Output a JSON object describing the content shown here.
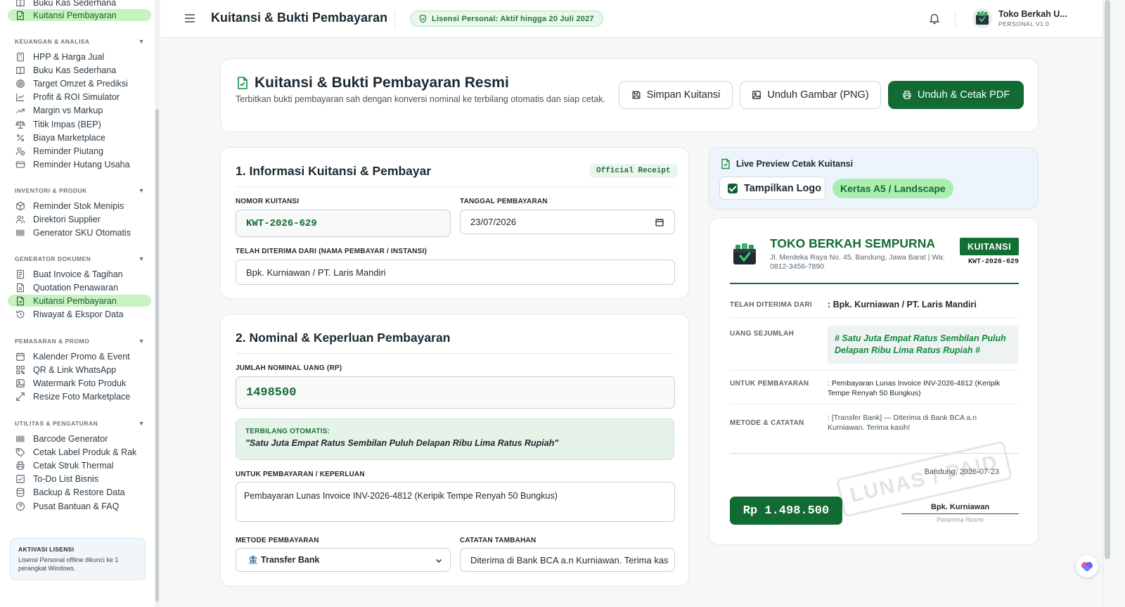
{
  "sidebar": {
    "top_partial": {
      "label": "Buku Kas Sederhana"
    },
    "top_active": {
      "label": "Kuitansi Pembayaran"
    },
    "sections": [
      {
        "title": "KEUANGAN & ANALISA",
        "items": [
          {
            "label": "HPP & Harga Jual",
            "icon": "calculator-icon"
          },
          {
            "label": "Buku Kas Sederhana",
            "icon": "book-icon"
          },
          {
            "label": "Target Omzet & Prediksi",
            "icon": "target-icon"
          },
          {
            "label": "Profit & ROI Simulator",
            "icon": "chart-line-icon"
          },
          {
            "label": "Margin vs Markup",
            "icon": "trending-up-icon"
          },
          {
            "label": "Titik Impas (BEP)",
            "icon": "scale-icon"
          },
          {
            "label": "Biaya Marketplace",
            "icon": "percent-icon"
          },
          {
            "label": "Reminder Piutang",
            "icon": "user-clock-icon"
          },
          {
            "label": "Reminder Hutang Usaha",
            "icon": "credit-card-icon"
          }
        ]
      },
      {
        "title": "INVENTORI & PRODUK",
        "items": [
          {
            "label": "Reminder Stok Menipis",
            "icon": "package-icon"
          },
          {
            "label": "Direktori Supplier",
            "icon": "users-icon"
          },
          {
            "label": "Generator SKU Otomatis",
            "icon": "barcode-icon"
          }
        ]
      },
      {
        "title": "GENERATOR DOKUMEN",
        "items": [
          {
            "label": "Buat Invoice & Tagihan",
            "icon": "invoice-icon"
          },
          {
            "label": "Quotation Penawaran",
            "icon": "document-icon"
          },
          {
            "label": "Kuitansi Pembayaran",
            "icon": "receipt-icon",
            "active": true
          },
          {
            "label": "Riwayat & Ekspor Data",
            "icon": "history-icon"
          }
        ]
      },
      {
        "title": "PEMASARAN & PROMO",
        "items": [
          {
            "label": "Kalender Promo & Event",
            "icon": "calendar-icon"
          },
          {
            "label": "QR & Link WhatsApp",
            "icon": "qr-icon"
          },
          {
            "label": "Watermark Foto Produk",
            "icon": "image-icon"
          },
          {
            "label": "Resize Foto Marketplace",
            "icon": "resize-icon"
          }
        ]
      },
      {
        "title": "UTILITAS & PENGATURAN",
        "items": [
          {
            "label": "Barcode Generator",
            "icon": "barcode-icon"
          },
          {
            "label": "Cetak Label Produk & Rak",
            "icon": "tag-icon"
          },
          {
            "label": "Cetak Struk Thermal",
            "icon": "printer-icon"
          },
          {
            "label": "To-Do List Bisnis",
            "icon": "checklist-icon"
          },
          {
            "label": "Backup & Restore Data",
            "icon": "database-icon"
          },
          {
            "label": "Pusat Bantuan & FAQ",
            "icon": "help-icon"
          }
        ]
      }
    ],
    "license": {
      "title": "AKTIVASI LISENSI",
      "text": "Lisensi Personal offline dikunci ke 1 perangkat Windows."
    }
  },
  "header": {
    "title": "Kuitansi & Bukti Pembayaran",
    "license_pill": "Lisensi Personal: Aktif hingga 20 Juli 2027",
    "user_name": "Toko Berkah U...",
    "user_sub": "PERSONAL V1.0"
  },
  "top_card": {
    "title": "Kuitansi & Bukti Pembayaran Resmi",
    "description": "Terbitkan bukti pembayaran sah dengan konversi nominal ke terbilang otomatis dan siap cetak.",
    "btn_save": "Simpan Kuitansi",
    "btn_png": "Unduh Gambar (PNG)",
    "btn_pdf": "Unduh & Cetak PDF"
  },
  "form1": {
    "title": "1. Informasi Kuitansi & Pembayar",
    "badge": "Official Receipt",
    "receipt_no_label": "NOMOR KUITANSI",
    "receipt_no": "KWT-2026-629",
    "date_label": "TANGGAL PEMBAYARAN",
    "date": "23/07/2026",
    "from_label": "TELAH DITERIMA DARI (NAMA PEMBAYAR / INSTANSI)",
    "from": "Bpk. Kurniawan / PT. Laris Mandiri"
  },
  "form2": {
    "title": "2. Nominal & Keperluan Pembayaran",
    "amount_label": "JUMLAH NOMINAL UANG (RP)",
    "amount": "1498500",
    "terbilang_label": "TERBILANG OTOMATIS:",
    "terbilang": "\"Satu Juta Empat Ratus Sembilan Puluh Delapan Ribu Lima Ratus Rupiah\"",
    "purpose_label": "UNTUK PEMBAYARAN / KEPERLUAN",
    "purpose": "Pembayaran Lunas Invoice INV-2026-4812 (Keripik Tempe Renyah 50 Bungkus)",
    "method_label": "METODE PEMBAYARAN",
    "method": "🏦 Transfer Bank",
    "note_label": "CATATAN TAMBAHAN",
    "note": "Diterima di Bank BCA a.n Kurniawan. Terima kas"
  },
  "preview": {
    "title": "Live Preview Cetak Kuitansi",
    "show_logo_label": "Tampilkan Logo",
    "show_logo": true,
    "paper": "Kertas A5 / Landscape"
  },
  "receipt": {
    "store": "TOKO BERKAH SEMPURNA",
    "address": "Jl. Merdeka Raya No. 45, Bandung, Jawa Barat | Wa: 0812-3456-7890",
    "badge": "KUITANSI",
    "number": "KWT-2026-629",
    "from_label": "TELAH DITERIMA DARI",
    "from": ": Bpk. Kurniawan / PT. Laris Mandiri",
    "amount_label": "UANG SEJUMLAH",
    "amount_words": "# Satu Juta Empat Ratus Sembilan Puluh Delapan Ribu Lima Ratus Rupiah #",
    "for_label": "UNTUK PEMBAYARAN",
    "for": ": Pembayaran Lunas Invoice INV-2026-4812 (Keripik Tempe Renyah 50 Bungkus)",
    "method_label": "METODE & CATATAN",
    "method": ": [Transfer Bank] — Diterima di Bank BCA a.n Kurniawan. Terima kasih!",
    "stamp": "LUNAS / PAID",
    "place_date": "Bandung, 2026-07-23",
    "amount": "Rp 1.498.500",
    "signer": "Bpk. Kurniawan",
    "signer_role": "Penerima Resmi"
  },
  "colors": {
    "brand": "#116b33",
    "accent": "#c8f2c0",
    "text": "#1c2830"
  }
}
